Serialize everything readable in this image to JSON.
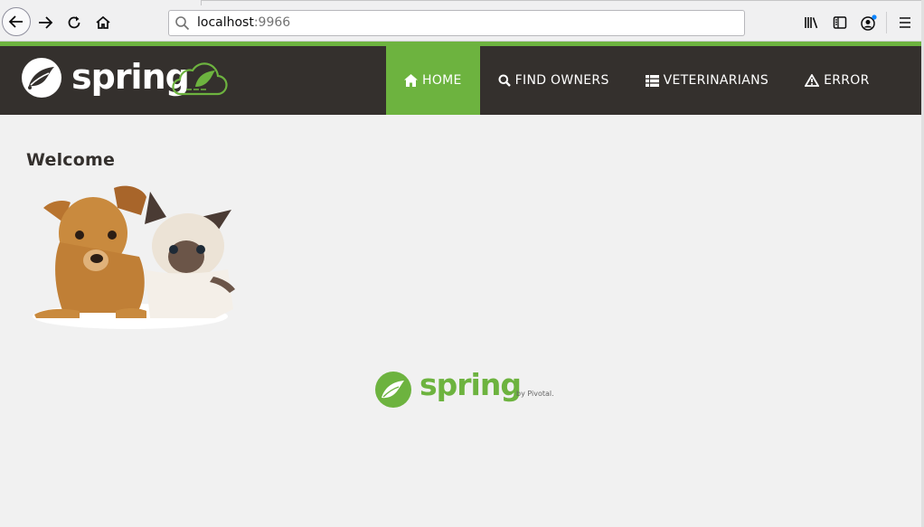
{
  "browser": {
    "url_host": "localhost",
    "url_port": ":9966"
  },
  "navbar": {
    "brand_text": "spring",
    "items": [
      {
        "label": "HOME",
        "icon": "home-icon",
        "active": true
      },
      {
        "label": "FIND OWNERS",
        "icon": "search-icon",
        "active": false
      },
      {
        "label": "VETERINARIANS",
        "icon": "list-icon",
        "active": false
      },
      {
        "label": "ERROR",
        "icon": "warning-icon",
        "active": false
      }
    ]
  },
  "main": {
    "heading": "Welcome"
  },
  "footer": {
    "brand_text": "spring",
    "by_text": "by Pivotal."
  },
  "colors": {
    "spring_green": "#6db33f",
    "navbar_bg": "#34302d",
    "page_bg": "#f1f1f1"
  }
}
